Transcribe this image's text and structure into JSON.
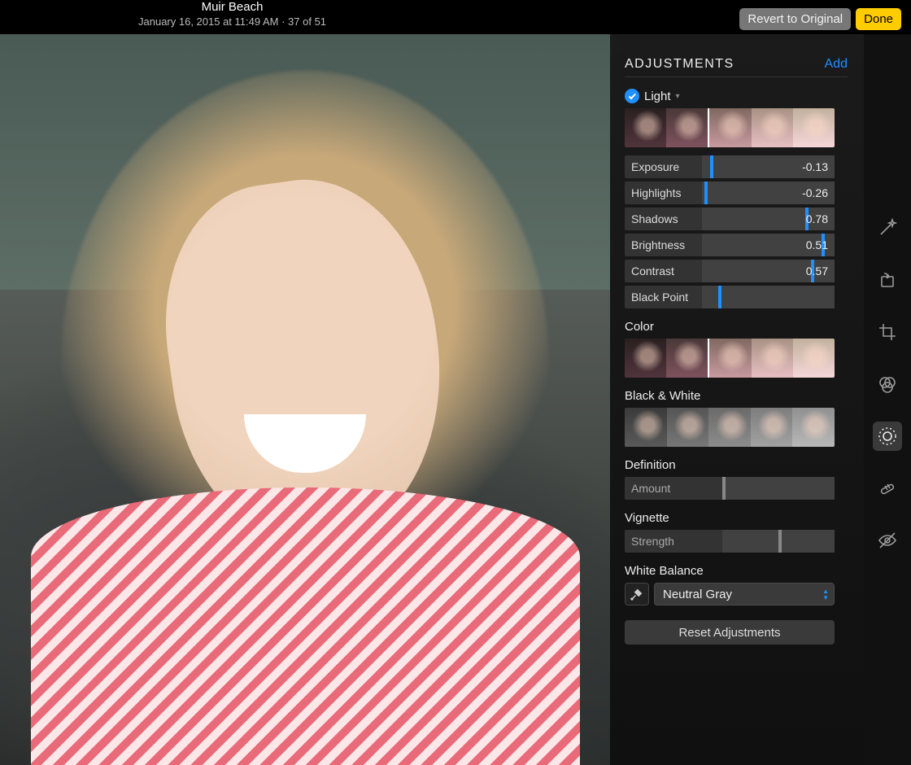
{
  "header": {
    "title": "Muir Beach",
    "meta": "January 16, 2015 at 11:49 AM  ·  37 of 51",
    "revert_label": "Revert to Original",
    "done_label": "Done"
  },
  "panel": {
    "title": "ADJUSTMENTS",
    "add_label": "Add",
    "reset_label": "Reset Adjustments"
  },
  "light": {
    "name": "Light",
    "enabled": true,
    "strip_handle_pct": 42,
    "sliders": [
      {
        "label": "Exposure",
        "value": "-0.13",
        "pos_pct": 6
      },
      {
        "label": "Highlights",
        "value": "-0.26",
        "pos_pct": 2
      },
      {
        "label": "Shadows",
        "value": "0.78",
        "pos_pct": 78
      },
      {
        "label": "Brightness",
        "value": "0.51",
        "pos_pct": 90
      },
      {
        "label": "Contrast",
        "value": "0.57",
        "pos_pct": 82
      },
      {
        "label": "Black Point",
        "value": "",
        "pos_pct": 12
      }
    ]
  },
  "color": {
    "name": "Color",
    "strip_handle_pct": 42
  },
  "bw": {
    "name": "Black & White"
  },
  "definition": {
    "name": "Definition",
    "slider_label": "Amount",
    "pos_pct": 0
  },
  "vignette": {
    "name": "Vignette",
    "slider_label": "Strength",
    "pos_pct": 50
  },
  "white_balance": {
    "name": "White Balance",
    "selected": "Neutral Gray"
  },
  "tools": [
    {
      "id": "magic-wand",
      "active": false
    },
    {
      "id": "rotate",
      "active": false
    },
    {
      "id": "crop",
      "active": false
    },
    {
      "id": "filters",
      "active": false
    },
    {
      "id": "adjust",
      "active": true
    },
    {
      "id": "retouch",
      "active": false
    },
    {
      "id": "redeye",
      "active": false
    }
  ],
  "colors": {
    "accent": "#1e90ff",
    "done": "#ffcc00"
  }
}
